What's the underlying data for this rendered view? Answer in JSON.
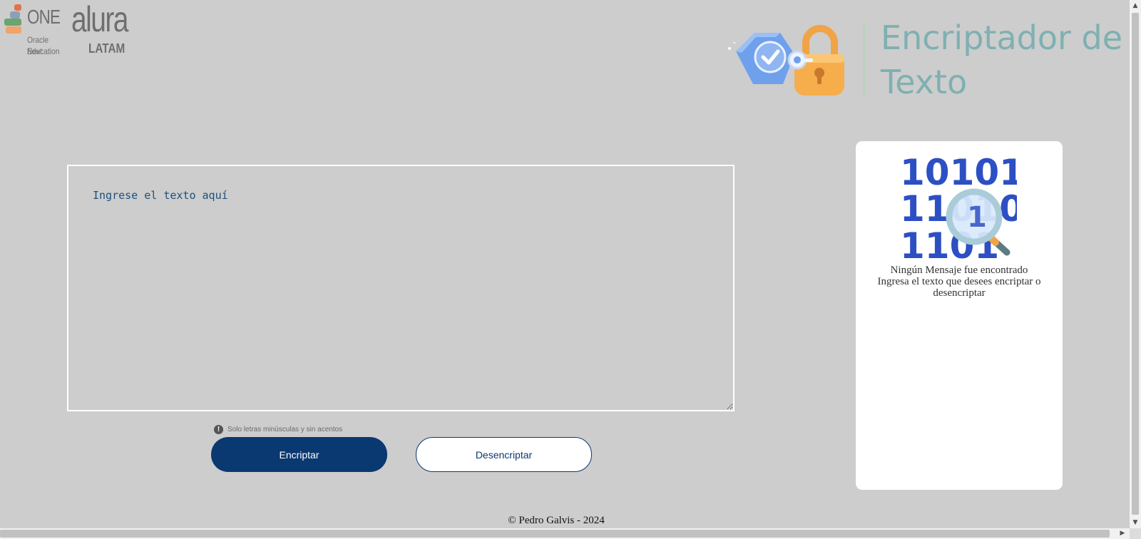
{
  "logos": {
    "one_title": "ONE",
    "one_sub1": "Oracle Next",
    "one_sub2": "Education",
    "alura": "alura",
    "latam": "LATAM"
  },
  "header": {
    "title": "Encriptador de Texto",
    "illustration_icon": "padlock-shield-check-icon"
  },
  "input": {
    "placeholder": "Ingrese el texto aquí",
    "value": ""
  },
  "hint": {
    "icon": "info-exclamation-icon",
    "text": "Solo letras minúsculas y sin acentos"
  },
  "buttons": {
    "encrypt_label": "Encriptar",
    "decrypt_label": "Desencriptar"
  },
  "output": {
    "illustration_digits": [
      "10101",
      "11010",
      "1101"
    ],
    "title": "Ningún Mensaje fue encontrado",
    "subtitle": "Ingresa el texto que desees encriptar o desencriptar"
  },
  "footer": {
    "text": "© Pedro Galvis - 2024"
  },
  "colors": {
    "background": "#cdcdcd",
    "primary": "#0a3871",
    "title": "#7fb0b2",
    "digits": "#2d4fc4"
  }
}
